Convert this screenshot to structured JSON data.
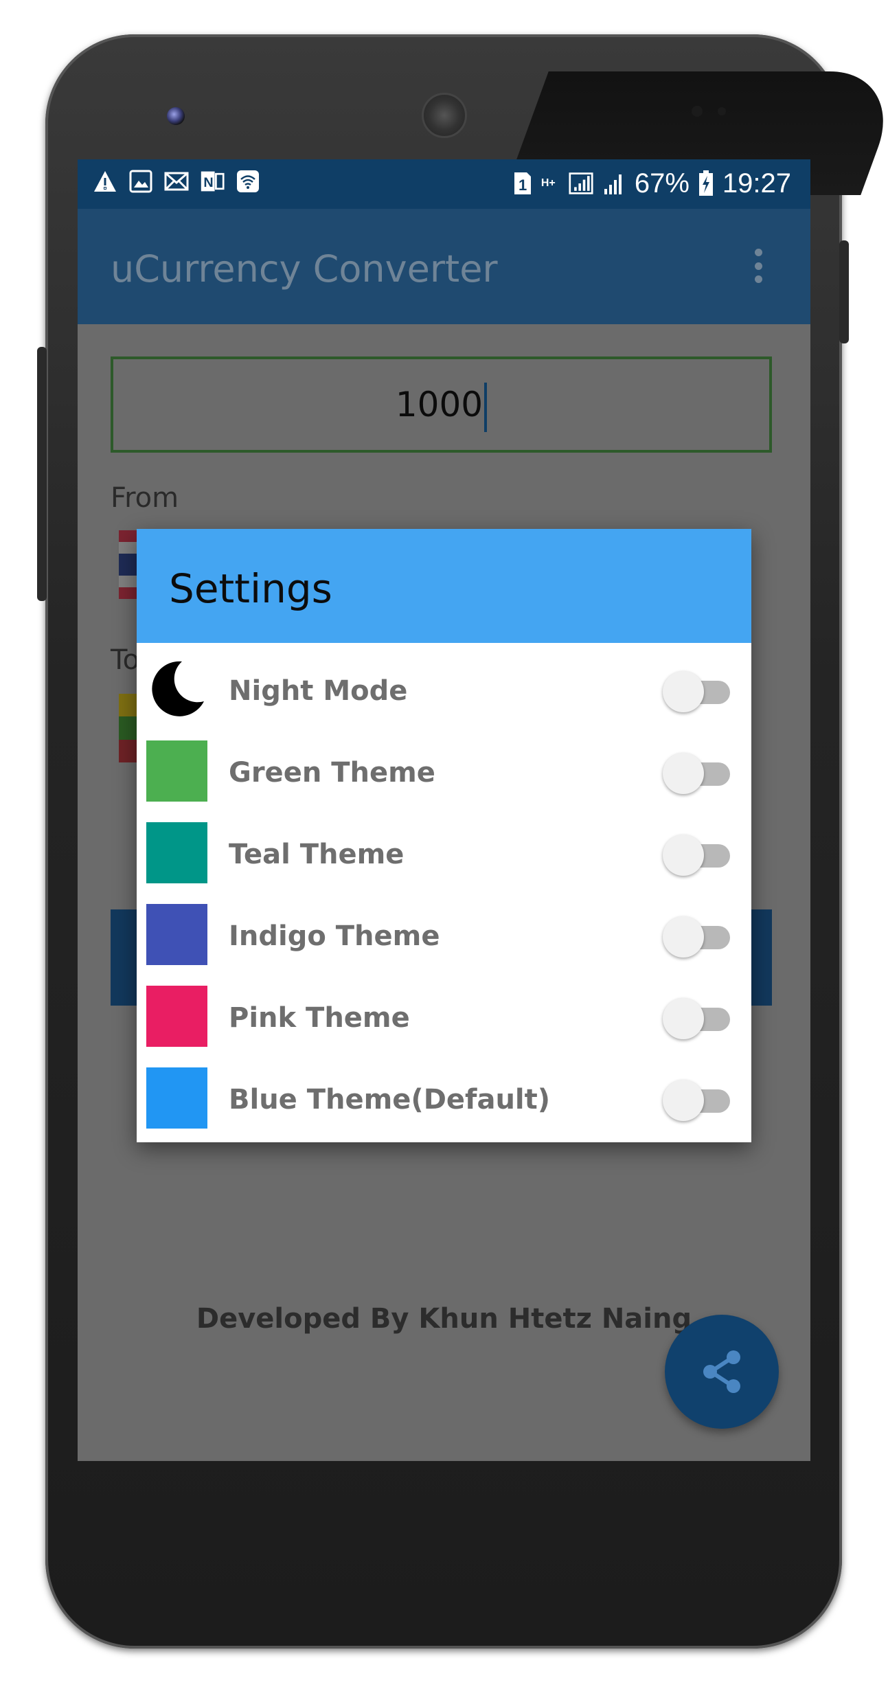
{
  "status_bar": {
    "battery": "67%",
    "time": "19:27",
    "sim_number": "1",
    "network": "H+",
    "icons_left": [
      "warning-icon",
      "gallery-icon",
      "mail-icon",
      "onenote-icon",
      "wifi-icon"
    ]
  },
  "app_bar": {
    "title": "uCurrency Converter",
    "menu_icon": "overflow-menu-icon"
  },
  "converter": {
    "amount": "1000",
    "from_label": "From",
    "to_label": "To"
  },
  "settings": {
    "title": "Settings",
    "items": [
      {
        "label": "Night Mode",
        "icon": "moon-icon",
        "color": "#000000",
        "enabled": false
      },
      {
        "label": "Green Theme",
        "icon": "color-swatch",
        "color": "#4caf50",
        "enabled": false
      },
      {
        "label": "Teal Theme",
        "icon": "color-swatch",
        "color": "#009688",
        "enabled": false
      },
      {
        "label": "Indigo Theme",
        "icon": "color-swatch",
        "color": "#3f51b5",
        "enabled": false
      },
      {
        "label": "Pink Theme",
        "icon": "color-swatch",
        "color": "#e91e63",
        "enabled": false
      },
      {
        "label": "Blue Theme(Default)",
        "icon": "color-swatch",
        "color": "#2196f3",
        "enabled": false
      }
    ]
  },
  "footer": {
    "credit": "Developed By Khun Htetz Naing",
    "share_icon": "share-icon"
  },
  "colors": {
    "status_bar": "#0f3e66",
    "app_bar": "#1f4a70",
    "dialog_header": "#44a5f2",
    "fab": "#10416d"
  }
}
